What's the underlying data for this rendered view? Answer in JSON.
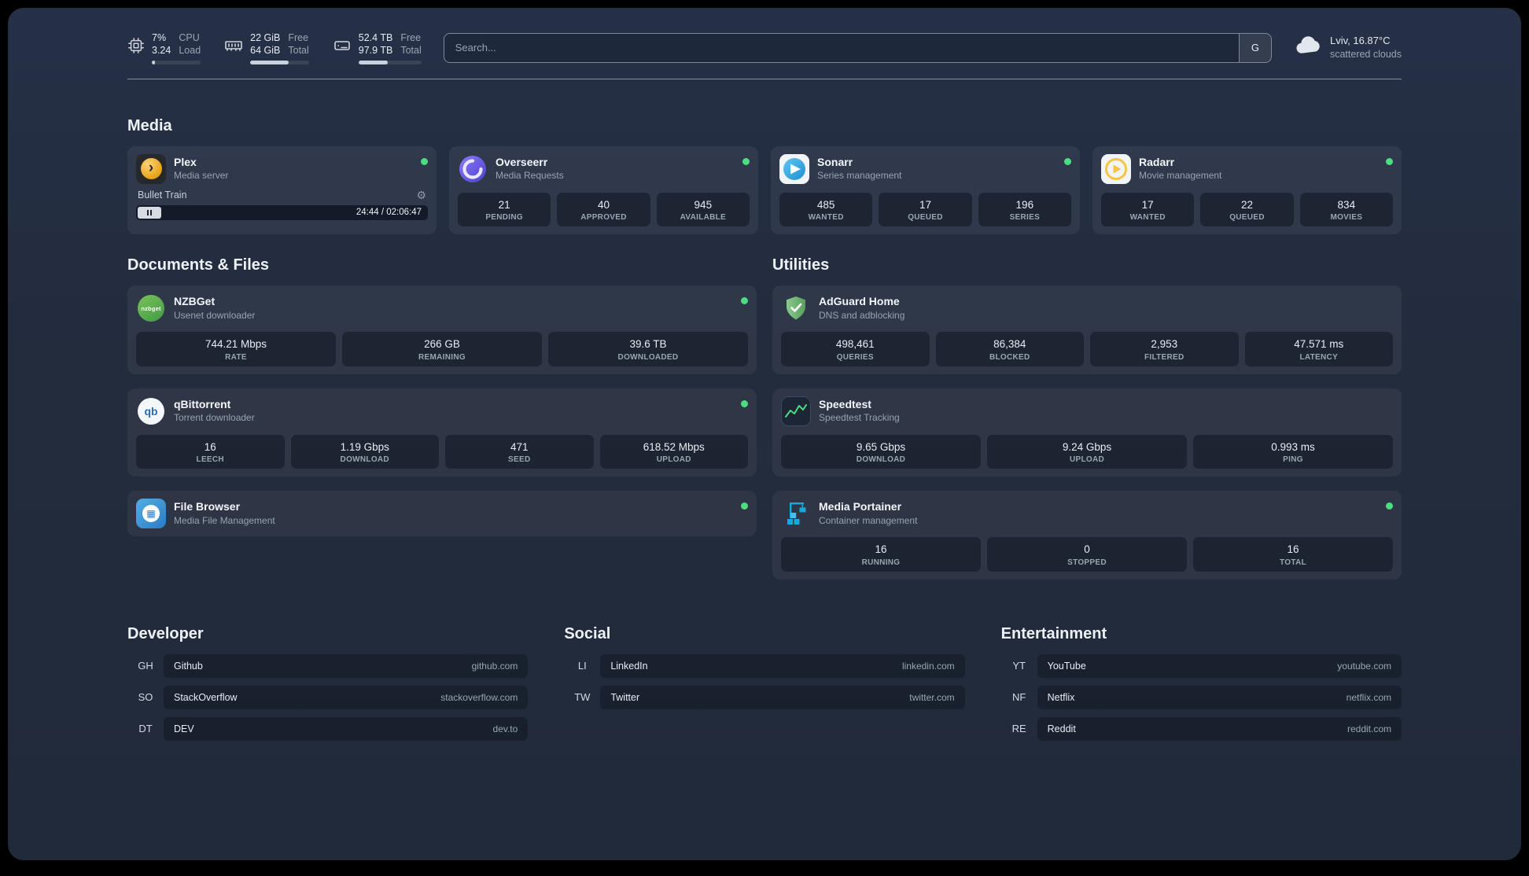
{
  "topbar": {
    "cpu": {
      "value1": "7%",
      "value2": "3.24",
      "label1": "CPU",
      "label2": "Load",
      "bar_percent": 7
    },
    "memory": {
      "value1": "22 GiB",
      "value2": "64 GiB",
      "label1": "Free",
      "label2": "Total",
      "bar_percent": 66
    },
    "disk": {
      "value1": "52.4 TB",
      "value2": "97.9 TB",
      "label1": "Free",
      "label2": "Total",
      "bar_percent": 47
    },
    "search": {
      "placeholder": "Search...",
      "provider": "G"
    },
    "weather": {
      "location": "Lviv, 16.87°C",
      "condition": "scattered clouds"
    }
  },
  "sections": {
    "media": {
      "title": "Media",
      "cards": [
        {
          "name": "Plex",
          "subtitle": "Media server",
          "status": "online",
          "player": {
            "track": "Bullet Train",
            "time": "24:44 / 02:06:47"
          }
        },
        {
          "name": "Overseerr",
          "subtitle": "Media Requests",
          "status": "online",
          "stats": [
            {
              "value": "21",
              "label": "PENDING"
            },
            {
              "value": "40",
              "label": "APPROVED"
            },
            {
              "value": "945",
              "label": "AVAILABLE"
            }
          ]
        },
        {
          "name": "Sonarr",
          "subtitle": "Series management",
          "status": "online",
          "stats": [
            {
              "value": "485",
              "label": "WANTED"
            },
            {
              "value": "17",
              "label": "QUEUED"
            },
            {
              "value": "196",
              "label": "SERIES"
            }
          ]
        },
        {
          "name": "Radarr",
          "subtitle": "Movie management",
          "status": "online",
          "stats": [
            {
              "value": "17",
              "label": "WANTED"
            },
            {
              "value": "22",
              "label": "QUEUED"
            },
            {
              "value": "834",
              "label": "MOVIES"
            }
          ]
        }
      ]
    },
    "documents": {
      "title": "Documents & Files",
      "cards": [
        {
          "name": "NZBGet",
          "subtitle": "Usenet downloader",
          "status": "online",
          "stats": [
            {
              "value": "744.21 Mbps",
              "label": "RATE"
            },
            {
              "value": "266 GB",
              "label": "REMAINING"
            },
            {
              "value": "39.6 TB",
              "label": "DOWNLOADED"
            }
          ]
        },
        {
          "name": "qBittorrent",
          "subtitle": "Torrent downloader",
          "status": "online",
          "stats": [
            {
              "value": "16",
              "label": "LEECH"
            },
            {
              "value": "1.19 Gbps",
              "label": "DOWNLOAD"
            },
            {
              "value": "471",
              "label": "SEED"
            },
            {
              "value": "618.52 Mbps",
              "label": "UPLOAD"
            }
          ]
        },
        {
          "name": "File Browser",
          "subtitle": "Media File Management",
          "status": "online",
          "stats": []
        }
      ]
    },
    "utilities": {
      "title": "Utilities",
      "cards": [
        {
          "name": "AdGuard Home",
          "subtitle": "DNS and adblocking",
          "stats": [
            {
              "value": "498,461",
              "label": "QUERIES"
            },
            {
              "value": "86,384",
              "label": "BLOCKED"
            },
            {
              "value": "2,953",
              "label": "FILTERED"
            },
            {
              "value": "47.571 ms",
              "label": "LATENCY"
            }
          ]
        },
        {
          "name": "Speedtest",
          "subtitle": "Speedtest Tracking",
          "stats": [
            {
              "value": "9.65 Gbps",
              "label": "DOWNLOAD"
            },
            {
              "value": "9.24 Gbps",
              "label": "UPLOAD"
            },
            {
              "value": "0.993 ms",
              "label": "PING"
            }
          ]
        },
        {
          "name": "Media Portainer",
          "subtitle": "Container management",
          "status": "online",
          "stats": [
            {
              "value": "16",
              "label": "RUNNING"
            },
            {
              "value": "0",
              "label": "STOPPED"
            },
            {
              "value": "16",
              "label": "TOTAL"
            }
          ]
        }
      ]
    }
  },
  "bookmarks": [
    {
      "title": "Developer",
      "items": [
        {
          "abbr": "GH",
          "name": "Github",
          "url": "github.com"
        },
        {
          "abbr": "SO",
          "name": "StackOverflow",
          "url": "stackoverflow.com"
        },
        {
          "abbr": "DT",
          "name": "DEV",
          "url": "dev.to"
        }
      ]
    },
    {
      "title": "Social",
      "items": [
        {
          "abbr": "LI",
          "name": "LinkedIn",
          "url": "linkedin.com"
        },
        {
          "abbr": "TW",
          "name": "Twitter",
          "url": "twitter.com"
        }
      ]
    },
    {
      "title": "Entertainment",
      "items": [
        {
          "abbr": "YT",
          "name": "YouTube",
          "url": "youtube.com"
        },
        {
          "abbr": "NF",
          "name": "Netflix",
          "url": "netflix.com"
        },
        {
          "abbr": "RE",
          "name": "Reddit",
          "url": "reddit.com"
        }
      ]
    }
  ],
  "colors": {
    "status_online": "#4ade80",
    "accent": "#18a8e0"
  }
}
